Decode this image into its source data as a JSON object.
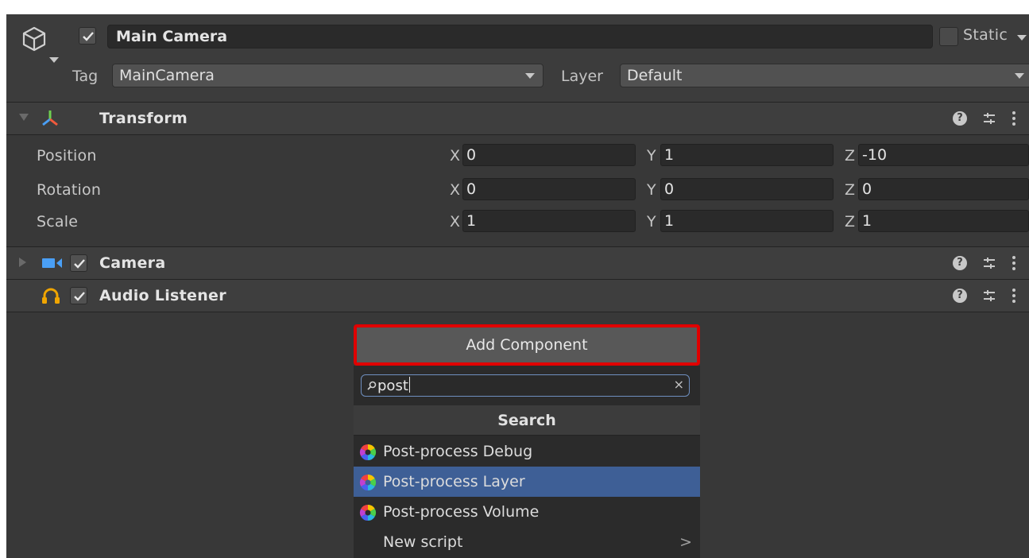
{
  "gameobject": {
    "name": "Main Camera",
    "active": true,
    "static_label": "Static",
    "tag_label": "Tag",
    "tag_value": "MainCamera",
    "layer_label": "Layer",
    "layer_value": "Default"
  },
  "transform": {
    "title": "Transform",
    "rows": [
      {
        "label": "Position",
        "x": "0",
        "y": "1",
        "z": "-10"
      },
      {
        "label": "Rotation",
        "x": "0",
        "y": "0",
        "z": "0"
      },
      {
        "label": "Scale",
        "x": "1",
        "y": "1",
        "z": "1"
      }
    ],
    "axis_labels": {
      "x": "X",
      "y": "Y",
      "z": "Z"
    }
  },
  "components": [
    {
      "title": "Camera",
      "enabled": true,
      "icon": "camera-icon"
    },
    {
      "title": "Audio Listener",
      "enabled": true,
      "icon": "headphones-icon"
    }
  ],
  "add_component": {
    "button_label": "Add Component",
    "search_value": "post",
    "popup_title": "Search",
    "items": [
      {
        "label": "Post-process Debug",
        "icon": "post-process-icon",
        "selected": false
      },
      {
        "label": "Post-process Layer",
        "icon": "post-process-icon",
        "selected": true
      },
      {
        "label": "Post-process Volume",
        "icon": "post-process-icon",
        "selected": false
      },
      {
        "label": "New script",
        "icon": "",
        "selected": false,
        "submenu": ">"
      }
    ]
  },
  "colors": {
    "panel": "#383838",
    "highlight": "#e00000",
    "selection": "#3e5f96",
    "camera_icon": "#4a9ff5",
    "audio_icon": "#f0a500"
  }
}
